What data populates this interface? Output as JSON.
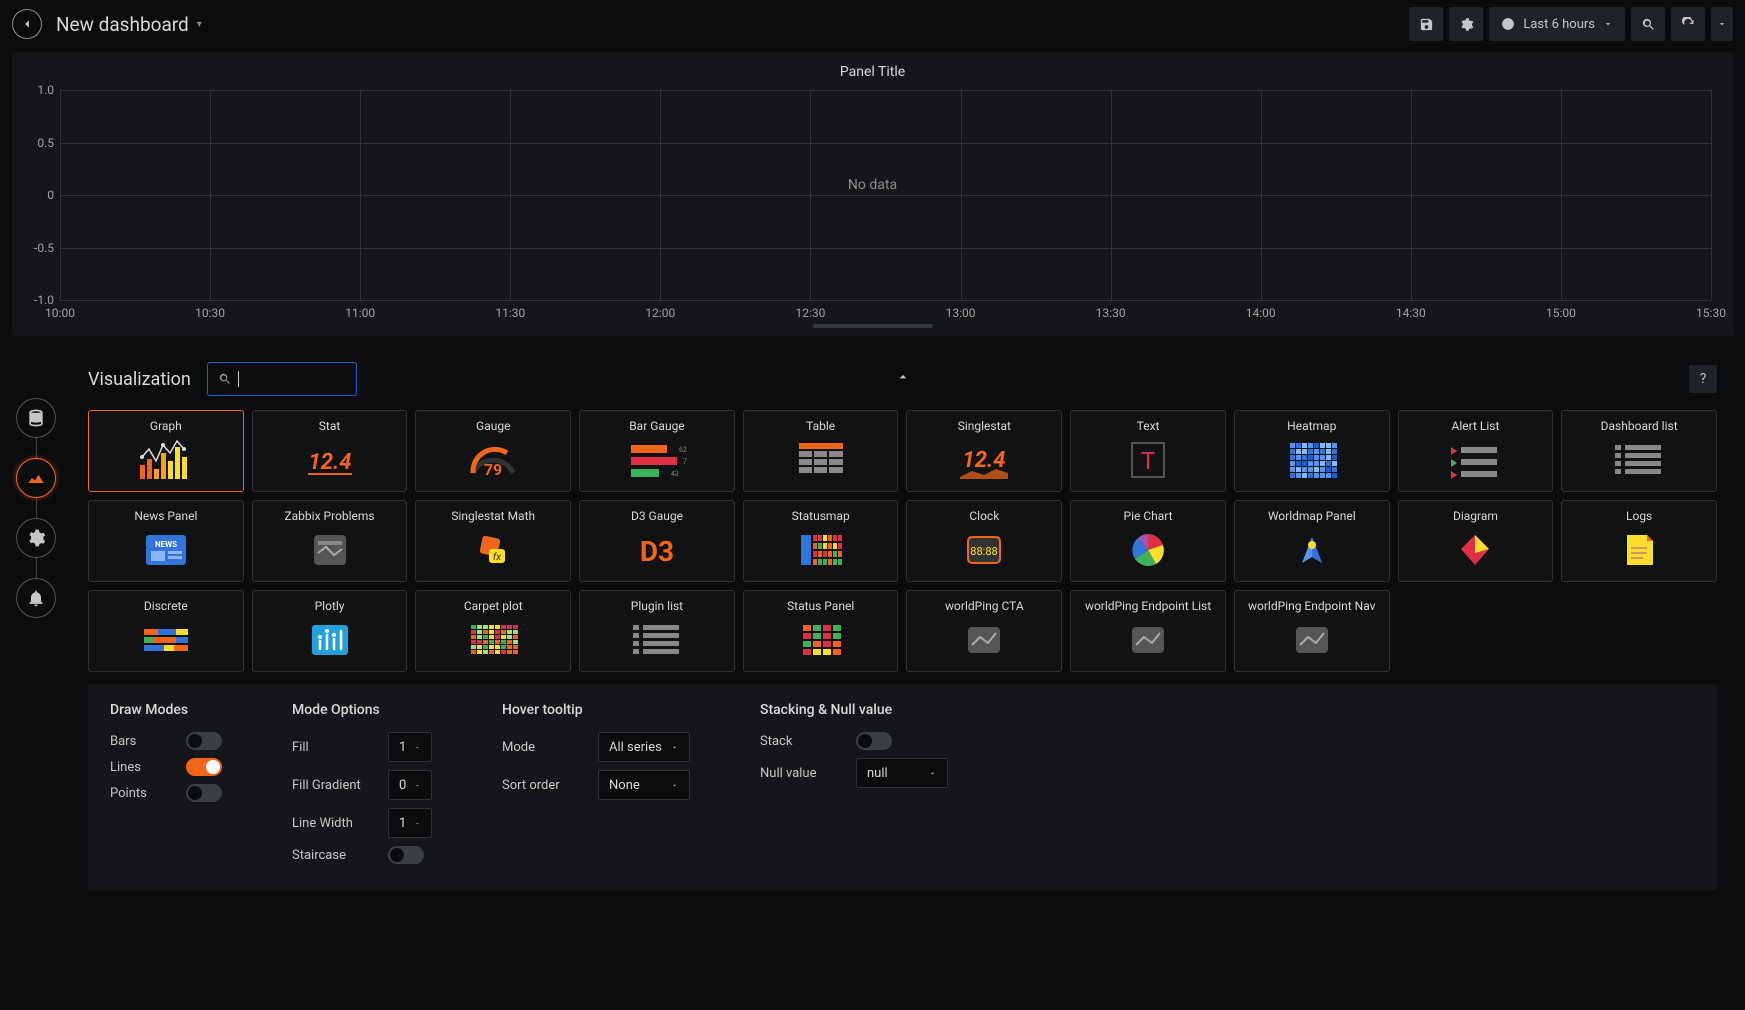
{
  "topbar": {
    "title": "New dashboard",
    "time_range": "Last 6 hours"
  },
  "panel": {
    "title": "Panel Title",
    "nodata": "No data",
    "y_ticks": [
      "1.0",
      "0.5",
      "0",
      "-0.5",
      "-1.0"
    ],
    "x_ticks": [
      "10:00",
      "10:30",
      "11:00",
      "11:30",
      "12:00",
      "12:30",
      "13:00",
      "13:30",
      "14:00",
      "14:30",
      "15:00",
      "15:30"
    ]
  },
  "chart_data": {
    "type": "line",
    "title": "Panel Title",
    "xlabel": "",
    "ylabel": "",
    "ylim": [
      -1.0,
      1.0
    ],
    "series": [],
    "x_ticks": [
      "10:00",
      "10:30",
      "11:00",
      "11:30",
      "12:00",
      "12:30",
      "13:00",
      "13:30",
      "14:00",
      "14:30",
      "15:00",
      "15:30"
    ],
    "no_data": true
  },
  "editor": {
    "section_title": "Visualization",
    "search_placeholder": "",
    "help": "?"
  },
  "viz_types": [
    {
      "name": "Graph",
      "icon": "graph"
    },
    {
      "name": "Stat",
      "icon": "stat"
    },
    {
      "name": "Gauge",
      "icon": "gauge"
    },
    {
      "name": "Bar Gauge",
      "icon": "bargauge"
    },
    {
      "name": "Table",
      "icon": "table"
    },
    {
      "name": "Singlestat",
      "icon": "singlestat"
    },
    {
      "name": "Text",
      "icon": "text"
    },
    {
      "name": "Heatmap",
      "icon": "heatmap"
    },
    {
      "name": "Alert List",
      "icon": "alertlist"
    },
    {
      "name": "Dashboard list",
      "icon": "dashlist"
    },
    {
      "name": "News Panel",
      "icon": "news"
    },
    {
      "name": "Zabbix Problems",
      "icon": "zabbix"
    },
    {
      "name": "Singlestat Math",
      "icon": "ssmath"
    },
    {
      "name": "D3 Gauge",
      "icon": "d3"
    },
    {
      "name": "Statusmap",
      "icon": "statusmap"
    },
    {
      "name": "Clock",
      "icon": "clock"
    },
    {
      "name": "Pie Chart",
      "icon": "pie"
    },
    {
      "name": "Worldmap Panel",
      "icon": "world"
    },
    {
      "name": "Diagram",
      "icon": "diagram"
    },
    {
      "name": "Logs",
      "icon": "logs"
    },
    {
      "name": "Discrete",
      "icon": "discrete"
    },
    {
      "name": "Plotly",
      "icon": "plotly"
    },
    {
      "name": "Carpet plot",
      "icon": "carpet"
    },
    {
      "name": "Plugin list",
      "icon": "plugin"
    },
    {
      "name": "Status Panel",
      "icon": "status"
    },
    {
      "name": "worldPing CTA",
      "icon": "wp"
    },
    {
      "name": "worldPing Endpoint List",
      "icon": "wp"
    },
    {
      "name": "worldPing Endpoint Nav",
      "icon": "wp"
    }
  ],
  "options": {
    "draw_modes": {
      "title": "Draw Modes",
      "bars": {
        "label": "Bars",
        "on": false
      },
      "lines": {
        "label": "Lines",
        "on": true
      },
      "points": {
        "label": "Points",
        "on": false
      }
    },
    "mode_options": {
      "title": "Mode Options",
      "fill": {
        "label": "Fill",
        "value": "1"
      },
      "fill_gradient": {
        "label": "Fill Gradient",
        "value": "0"
      },
      "line_width": {
        "label": "Line Width",
        "value": "1"
      },
      "staircase": {
        "label": "Staircase",
        "on": false
      }
    },
    "hover": {
      "title": "Hover tooltip",
      "mode": {
        "label": "Mode",
        "value": "All series"
      },
      "sort": {
        "label": "Sort order",
        "value": "None"
      }
    },
    "stacking": {
      "title": "Stacking & Null value",
      "stack": {
        "label": "Stack",
        "on": false
      },
      "null": {
        "label": "Null value",
        "value": "null"
      }
    }
  }
}
